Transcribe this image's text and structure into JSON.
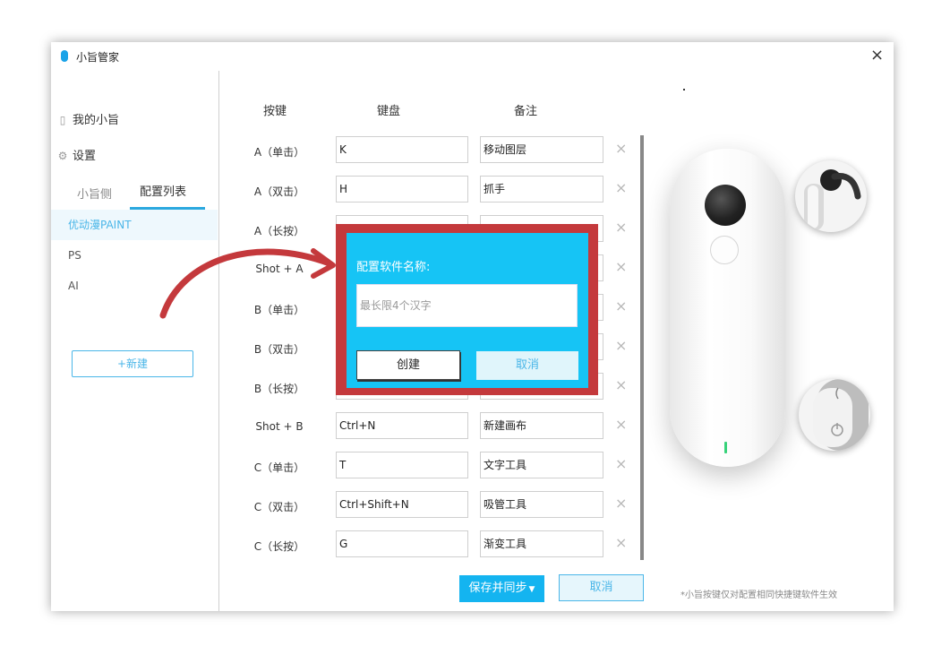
{
  "window": {
    "title": "小旨管家",
    "close_glyph": "×"
  },
  "sidebar": {
    "nav": [
      {
        "label": "我的小旨",
        "icon": "mouse-icon"
      },
      {
        "label": "设置",
        "icon": "gear-icon"
      }
    ],
    "tabs": [
      {
        "label": "小旨侧",
        "active": false
      },
      {
        "label": "配置列表",
        "active": true
      }
    ],
    "configs": [
      {
        "label": "优动漫PAINT",
        "active": true
      },
      {
        "label": "PS",
        "active": false
      },
      {
        "label": "AI",
        "active": false
      }
    ],
    "new_button": "+新建"
  },
  "table": {
    "headers": {
      "key": "按键",
      "keyboard": "键盘",
      "note": "备注"
    },
    "rows": [
      {
        "key": "A（单击）",
        "keyboard": "K",
        "note": "移动图层"
      },
      {
        "key": "A（双击）",
        "keyboard": "H",
        "note": "抓手"
      },
      {
        "key": "A（长按）",
        "keyboard": "",
        "note": ""
      },
      {
        "key": "Shot + A",
        "keyboard": "",
        "note": ""
      },
      {
        "key": "B（单击）",
        "keyboard": "",
        "note": ""
      },
      {
        "key": "B（双击）",
        "keyboard": "",
        "note": ""
      },
      {
        "key": "B（长按）",
        "keyboard": "",
        "note": ""
      },
      {
        "key": "Shot + B",
        "keyboard": "Ctrl+N",
        "note": "新建画布"
      },
      {
        "key": "C（单击）",
        "keyboard": "T",
        "note": "文字工具"
      },
      {
        "key": "C（双击）",
        "keyboard": "Ctrl+Shift+N",
        "note": "吸管工具"
      },
      {
        "key": "C（长按）",
        "keyboard": "G",
        "note": "渐变工具"
      }
    ],
    "delete_glyph": "×"
  },
  "footer": {
    "save_button": "保存并同步",
    "cancel_button": "取消",
    "note": "*小旨按键仅对配置相同快捷键软件生效"
  },
  "dialog": {
    "title": "配置软件名称:",
    "input_placeholder": "最长限4个汉字",
    "create_button": "创建",
    "cancel_button": "取消"
  },
  "colors": {
    "accent": "#14b4f0",
    "dialog_bg": "#16c4f5",
    "highlight_frame": "#c4393c",
    "arrow": "#c4393c",
    "led": "#38d27a"
  }
}
